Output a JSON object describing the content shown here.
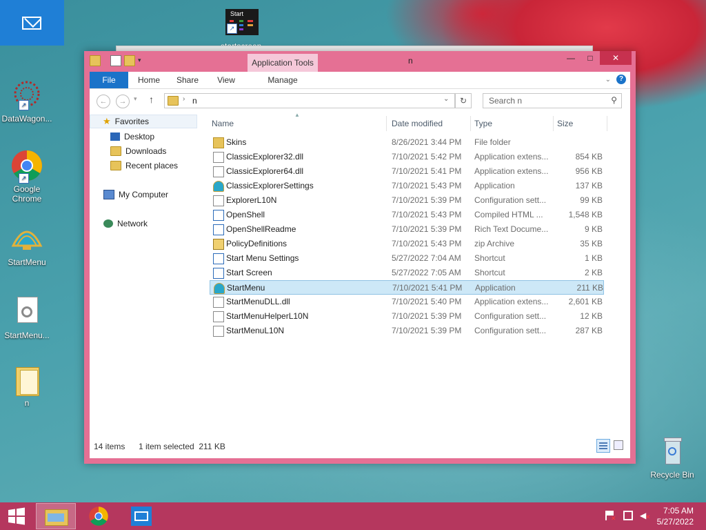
{
  "desktop": {
    "icons": [
      {
        "label": "DataWagon..."
      },
      {
        "label": "Google\nChrome"
      },
      {
        "label": "StartMenu"
      },
      {
        "label": "StartMenu..."
      },
      {
        "label": "n"
      },
      {
        "label": "Recycle Bin"
      }
    ],
    "start_tile_label": "Start",
    "start_tile_caption": "startscreen"
  },
  "window": {
    "title": "n",
    "context_tab_group": "Application Tools",
    "tabs": [
      "File",
      "Home",
      "Share",
      "View",
      "Manage"
    ],
    "address": {
      "breadcrumb": "n"
    },
    "search": {
      "placeholder": "Search n"
    },
    "nav": {
      "favorites": "Favorites",
      "desktop": "Desktop",
      "downloads": "Downloads",
      "recent": "Recent places",
      "computer": "My Computer",
      "network": "Network"
    },
    "columns": {
      "name": "Name",
      "date": "Date modified",
      "type": "Type",
      "size": "Size"
    },
    "files": [
      {
        "name": "Skins",
        "date": "8/26/2021 3:44 PM",
        "type": "File folder",
        "size": "",
        "icon": "folder-icon"
      },
      {
        "name": "ClassicExplorer32.dll",
        "date": "7/10/2021 5:42 PM",
        "type": "Application extens...",
        "size": "854 KB",
        "icon": "dll-icon"
      },
      {
        "name": "ClassicExplorer64.dll",
        "date": "7/10/2021 5:41 PM",
        "type": "Application extens...",
        "size": "956 KB",
        "icon": "dll-icon"
      },
      {
        "name": "ClassicExplorerSettings",
        "date": "7/10/2021 5:43 PM",
        "type": "Application",
        "size": "137 KB",
        "icon": "shell-icon"
      },
      {
        "name": "ExplorerL10N",
        "date": "7/10/2021 5:39 PM",
        "type": "Configuration sett...",
        "size": "99 KB",
        "icon": "config-icon"
      },
      {
        "name": "OpenShell",
        "date": "7/10/2021 5:43 PM",
        "type": "Compiled HTML ...",
        "size": "1,548 KB",
        "icon": "help-icon"
      },
      {
        "name": "OpenShellReadme",
        "date": "7/10/2021 5:39 PM",
        "type": "Rich Text Docume...",
        "size": "9 KB",
        "icon": "doc-icon"
      },
      {
        "name": "PolicyDefinitions",
        "date": "7/10/2021 5:43 PM",
        "type": "zip Archive",
        "size": "35 KB",
        "icon": "zip-icon"
      },
      {
        "name": "Start Menu Settings",
        "date": "5/27/2022 7:04 AM",
        "type": "Shortcut",
        "size": "1 KB",
        "icon": "shortcut-icon"
      },
      {
        "name": "Start Screen",
        "date": "5/27/2022 7:05 AM",
        "type": "Shortcut",
        "size": "2 KB",
        "icon": "shortcut-icon"
      },
      {
        "name": "StartMenu",
        "date": "7/10/2021 5:41 PM",
        "type": "Application",
        "size": "211 KB",
        "icon": "shell-icon"
      },
      {
        "name": "StartMenuDLL.dll",
        "date": "7/10/2021 5:40 PM",
        "type": "Application extens...",
        "size": "2,601 KB",
        "icon": "dll-icon"
      },
      {
        "name": "StartMenuHelperL10N",
        "date": "7/10/2021 5:39 PM",
        "type": "Configuration sett...",
        "size": "12 KB",
        "icon": "config-icon"
      },
      {
        "name": "StartMenuL10N",
        "date": "7/10/2021 5:39 PM",
        "type": "Configuration sett...",
        "size": "287 KB",
        "icon": "config-icon"
      }
    ],
    "selected_index": 10,
    "status": {
      "items": "14 items",
      "selection": "1 item selected  211 KB"
    }
  },
  "taskbar": {
    "time": "7:05 AM",
    "date": "5/27/2022"
  },
  "colors": {
    "window_frame": "#e57094",
    "file_tab": "#1a73c9",
    "taskbar": "#b5375e",
    "selection": "#cde8f7"
  }
}
